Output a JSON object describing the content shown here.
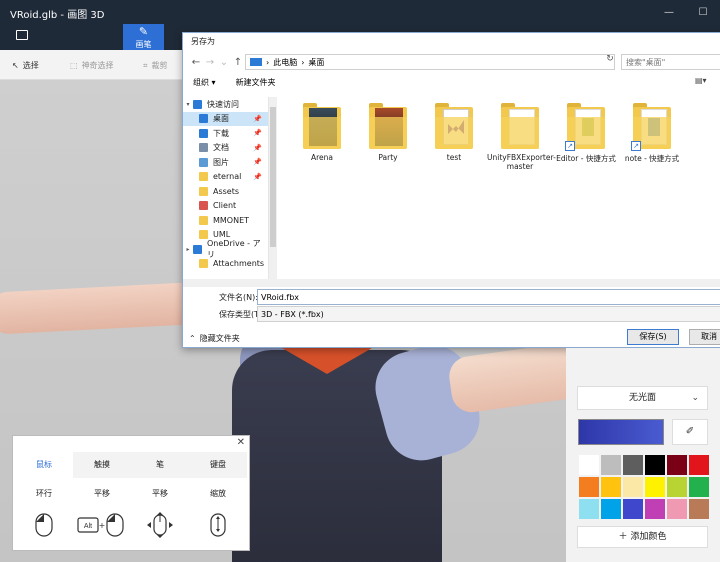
{
  "window": {
    "title": "VRoid.glb - 画图 3D"
  },
  "ribbon": {
    "brushes_label": "画笔"
  },
  "toolbar": {
    "select_label": "选择",
    "magic_select_label": "神奇选择",
    "crop_label": "裁剪"
  },
  "dialog": {
    "title": "另存为",
    "address": {
      "root": "此电脑",
      "sep": "›",
      "current": "桌面"
    },
    "search_placeholder": "搜索\"桌面\"",
    "organize_label": "组织 ▾",
    "new_folder_label": "新建文件夹",
    "nav_items": [
      {
        "label": "快速访问",
        "icon": "star-icon",
        "color": "#2b7bd6",
        "expand": "▾"
      },
      {
        "label": "桌面",
        "icon": "desktop-icon",
        "color": "#2b7bd6",
        "pin": "📌",
        "selected": true
      },
      {
        "label": "下载",
        "icon": "download-icon",
        "color": "#2b7bd6",
        "pin": "📌"
      },
      {
        "label": "文档",
        "icon": "documents-icon",
        "color": "#7a8ea8",
        "pin": "📌"
      },
      {
        "label": "图片",
        "icon": "pictures-icon",
        "color": "#5b9bd5",
        "pin": "📌"
      },
      {
        "label": "eternal",
        "icon": "folder-icon",
        "color": "#f2c94c",
        "pin": "📌"
      },
      {
        "label": "Assets",
        "icon": "folder-icon",
        "color": "#f2c94c"
      },
      {
        "label": "Client",
        "icon": "app-icon",
        "color": "#d9534f"
      },
      {
        "label": "MMONET",
        "icon": "folder-icon",
        "color": "#f2c94c"
      },
      {
        "label": "UML",
        "icon": "folder-icon",
        "color": "#f2c94c"
      },
      {
        "label": "OneDrive - アリ",
        "icon": "onedrive-icon",
        "color": "#2b7bd6",
        "expand": "▸"
      },
      {
        "label": "Attachments",
        "icon": "folder-icon",
        "color": "#f2c94c"
      }
    ],
    "files": [
      {
        "name": "Arena",
        "kind": "image",
        "color": "#3a4c5a"
      },
      {
        "name": "Party",
        "kind": "image",
        "color": "#a84a2a"
      },
      {
        "name": "test",
        "kind": "vs",
        "color": "#6a3fb5"
      },
      {
        "name": "UnityFBXExporter-master",
        "kind": "doc",
        "color": "#ffffff"
      },
      {
        "name": "Editor - 快捷方式",
        "kind": "shortcut",
        "color": "#7cb342"
      },
      {
        "name": "note - 快捷方式",
        "kind": "shortcut",
        "color": "#2b7bd6"
      }
    ],
    "filename_label": "文件名(N):",
    "filename_value": "VRoid.fbx",
    "filetype_label": "保存类型(T):",
    "filetype_value": "3D - FBX (*.fbx)",
    "hide_folders_label": "隐藏文件夹",
    "save_label": "保存(S)",
    "cancel_label": "取消"
  },
  "right_panel": {
    "finish_value": "无光面",
    "add_color_label": "添加颜色",
    "palette": [
      "#ffffff",
      "#bdbdbd",
      "#5e5e5e",
      "#000000",
      "#7a0015",
      "#e3151c",
      "#f47d20",
      "#ffc20e",
      "#fbe8a6",
      "#fff200",
      "#b7d432",
      "#22b14c",
      "#8ee0f0",
      "#00a2e8",
      "#3f48cc",
      "#c13fb5",
      "#ef9ab2",
      "#b97a57"
    ]
  },
  "input_guide": {
    "tabs": [
      "鼠标",
      "触摸",
      "笔",
      "键盘"
    ],
    "active_tab": 0,
    "actions": [
      "环行",
      "平移",
      "平移",
      "缩放"
    ],
    "alt_key": "Alt"
  }
}
